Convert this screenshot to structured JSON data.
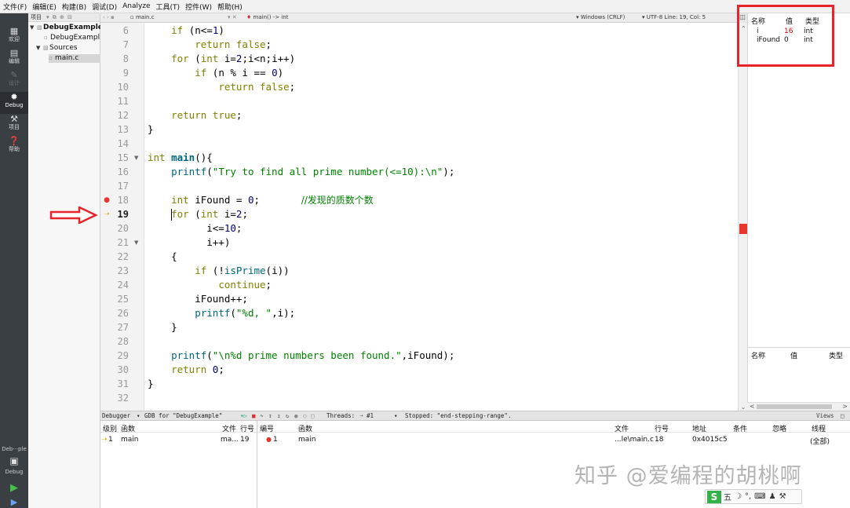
{
  "menubar": {
    "items": [
      "文件(F)",
      "编辑(E)",
      "构建(B)",
      "调试(D)",
      "Analyze",
      "工具(T)",
      "控件(W)",
      "帮助(H)"
    ]
  },
  "modes": {
    "welcome": "欢迎",
    "edit": "编辑",
    "design": "设计",
    "debug": "Debug",
    "project": "项目",
    "help": "帮助",
    "kit_name": "Deb···ple",
    "kit_mode": "Debug"
  },
  "project": {
    "header": "项目",
    "root": "DebugExample",
    "pro_file": "DebugExampl",
    "sources": "Sources",
    "file": "main.c"
  },
  "editor": {
    "filename": "main.c",
    "symbol": "main() -> int",
    "encoding": "Windows (CRLF)",
    "position": "UTF-8 Line: 19, Col: 5",
    "current_line": 19,
    "breakpoint_line": 18,
    "lines": [
      {
        "n": 6,
        "text": "    if (n<=1)"
      },
      {
        "n": 7,
        "text": "        return false;"
      },
      {
        "n": 8,
        "text": "    for (int i=2;i<n;i++)"
      },
      {
        "n": 9,
        "text": "        if (n % i == 0)"
      },
      {
        "n": 10,
        "text": "            return false;"
      },
      {
        "n": 11,
        "text": ""
      },
      {
        "n": 12,
        "text": "    return true;"
      },
      {
        "n": 13,
        "text": "}"
      },
      {
        "n": 14,
        "text": ""
      },
      {
        "n": 15,
        "text": "int main(){"
      },
      {
        "n": 16,
        "text": "    printf(\"Try to find all prime number(<=10):\\n\");"
      },
      {
        "n": 17,
        "text": ""
      },
      {
        "n": 18,
        "text": "    int iFound = 0;       //发现的质数个数"
      },
      {
        "n": 19,
        "text": "    for (int i=2;"
      },
      {
        "n": 20,
        "text": "          i<=10;"
      },
      {
        "n": 21,
        "text": "          i++)"
      },
      {
        "n": 22,
        "text": "    {"
      },
      {
        "n": 23,
        "text": "        if (!isPrime(i))"
      },
      {
        "n": 24,
        "text": "            continue;"
      },
      {
        "n": 25,
        "text": "        iFound++;"
      },
      {
        "n": 26,
        "text": "        printf(\"%d, \",i);"
      },
      {
        "n": 27,
        "text": "    }"
      },
      {
        "n": 28,
        "text": ""
      },
      {
        "n": 29,
        "text": "    printf(\"\\n%d prime numbers been found.\",iFound);"
      },
      {
        "n": 30,
        "text": "    return 0;"
      },
      {
        "n": 31,
        "text": "}"
      },
      {
        "n": 32,
        "text": ""
      }
    ]
  },
  "locals": {
    "headers": [
      "名称",
      "值",
      "类型"
    ],
    "rows": [
      {
        "name": "i",
        "value": "16",
        "type": "int",
        "changed": true
      },
      {
        "name": "iFound",
        "value": "0",
        "type": "int",
        "changed": false
      }
    ]
  },
  "expressions": {
    "headers": [
      "名称",
      "值",
      "类型"
    ]
  },
  "debugger_bar": {
    "view": "Debugger",
    "engine": "GDB for \"DebugExample\"",
    "threads_label": "Threads:",
    "thread": "#1",
    "status": "Stopped: \"end-stepping-range\".",
    "views": "Views"
  },
  "stack": {
    "headers": [
      "级别",
      "函数",
      "文件",
      "行号"
    ],
    "row": {
      "level": "1",
      "function": "main",
      "file": "ma...",
      "line": "19"
    }
  },
  "breakpoints": {
    "headers": [
      "编号",
      "函数",
      "文件",
      "行号",
      "地址",
      "条件",
      "忽略",
      "线程"
    ],
    "row": {
      "num": "1",
      "function": "main",
      "file": "...le\\main.c",
      "line": "18",
      "address": "0x4015c5",
      "condition": "",
      "ignore": "",
      "threads": "(全部)"
    }
  },
  "watermark": "知乎 @爱编程的胡桃啊",
  "ime": {
    "logo": "S",
    "mode": "五"
  },
  "colors": {
    "annotation_red": "#e8232a",
    "breakpoint": "#e8342f",
    "changed_value": "#d40000"
  }
}
